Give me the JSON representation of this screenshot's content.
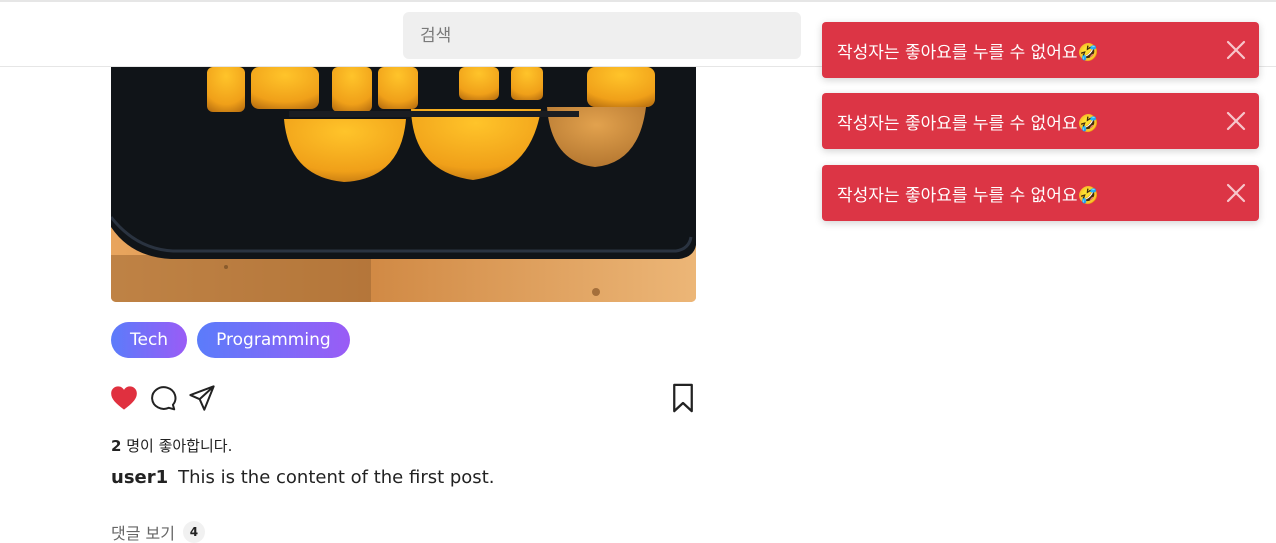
{
  "search": {
    "placeholder": "검색"
  },
  "post": {
    "tags": [
      "Tech",
      "Programming"
    ],
    "likes": {
      "count": "2",
      "text": " 명이 좋아합니다."
    },
    "author": "user1",
    "content": "This is the content of the first post.",
    "comments": {
      "label": "댓글 보기",
      "count": "4"
    },
    "liked": true
  },
  "toasts": [
    {
      "message": "작성자는 좋아요를 누를 수 없어요🤣"
    },
    {
      "message": "작성자는 좋아요를 누를 수 없어요🤣"
    },
    {
      "message": "작성자는 좋아요를 누를 수 없어요🤣"
    }
  ],
  "icons": {
    "like": "heart-icon",
    "comment": "comment-icon",
    "share": "send-icon",
    "bookmark": "bookmark-icon",
    "close": "close-icon"
  },
  "colors": {
    "heart": "#e0303f",
    "toast": "#dc3545",
    "tag_start": "#5b7cfa",
    "tag_end": "#9a5cf6"
  }
}
